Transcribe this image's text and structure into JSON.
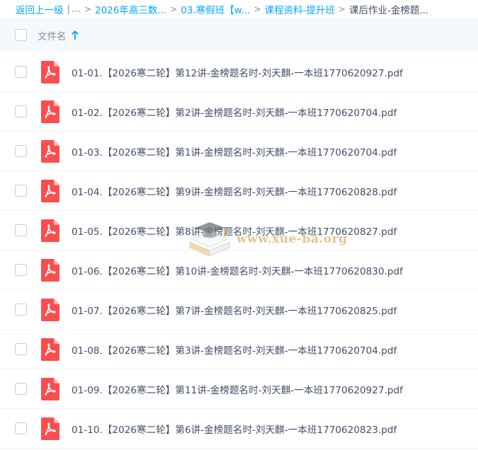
{
  "breadcrumb": {
    "back": "返回上一级",
    "pipe": "|",
    "dots": "...",
    "sep": ">",
    "items": [
      "2026年高三数...",
      "03.寒假班【w...",
      "课程资料-提升班"
    ],
    "current": "课后作业-金榜题..."
  },
  "header": {
    "column_label": "文件名",
    "sort_icon": "arrow-up-icon"
  },
  "files": [
    "01-01.【2026寒二轮】第12讲-金榜题名时-刘天麒-一本班1770620927.pdf",
    "01-02.【2026寒二轮】第2讲-金榜题名时-刘天麒-一本班1770620704.pdf",
    "01-03.【2026寒二轮】第1讲-金榜题名时-刘天麒-一本班1770620704.pdf",
    "01-04.【2026寒二轮】第9讲-金榜题名时-刘天麒-一本班1770620828.pdf",
    "01-05.【2026寒二轮】第8讲-金榜题名时-刘天麒-一本班1770620827.pdf",
    "01-06.【2026寒二轮】第10讲-金榜题名时-刘天麒-一本班1770620830.pdf",
    "01-07.【2026寒二轮】第7讲-金榜题名时-刘天麒-一本班1770620825.pdf",
    "01-08.【2026寒二轮】第3讲-金榜题名时-刘天麒-一本班1770620704.pdf",
    "01-09.【2026寒二轮】第11讲-金榜题名时-刘天麒-一本班1770620927.pdf",
    "01-10.【2026寒二轮】第6讲-金榜题名时-刘天麒-一本班1770620823.pdf"
  ],
  "file_icon": "pdf-file-icon",
  "watermark": {
    "text": "www.xue-ba.org",
    "icon": "graduation-cap-book-logo"
  },
  "colors": {
    "link": "#06a7ff",
    "text": "#424e67",
    "muted": "#878c9c",
    "header_bg": "#f5f9fd",
    "pdf_red": "#fa4e4e"
  }
}
